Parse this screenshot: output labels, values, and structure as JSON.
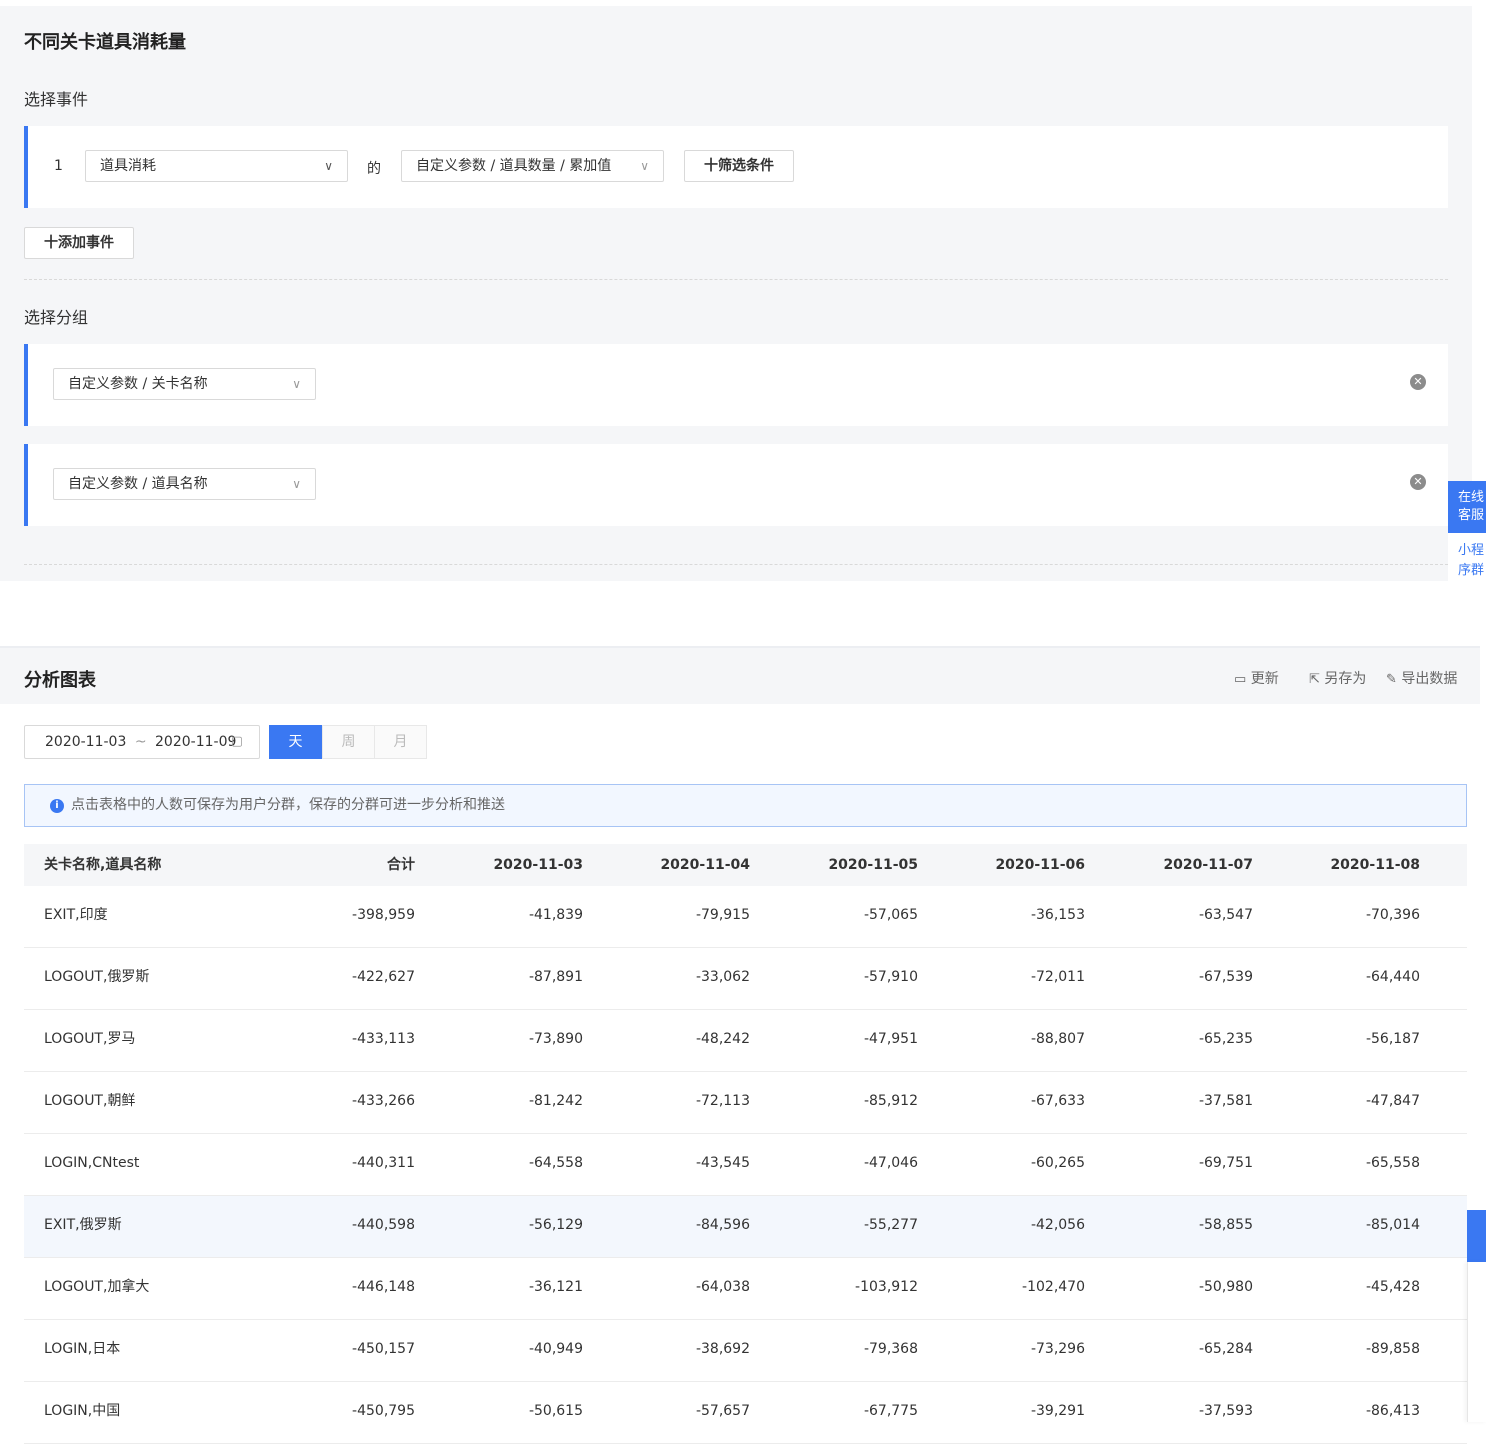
{
  "config": {
    "title": "不同关卡道具消耗量",
    "event_section_label": "选择事件",
    "event_row": {
      "index": "1",
      "event_select": "道具消耗",
      "of_label": "的",
      "metric_select": "自定义参数 / 道具数量 / 累加值",
      "filter_button": "十筛选条件"
    },
    "add_event_button": "十添加事件",
    "group_section_label": "选择分组",
    "groups": [
      {
        "select": "自定义参数 / 关卡名称"
      },
      {
        "select": "自定义参数 / 道具名称"
      }
    ],
    "side_tab": "在线客服",
    "side_link": "小程序群"
  },
  "analysis": {
    "title": "分析图表",
    "actions": {
      "refresh": "更新",
      "save_as": "另存为",
      "export": "导出数据"
    },
    "date_start": "2020-11-03",
    "date_sep": "~",
    "date_end": "2020-11-09",
    "granularity": [
      "天",
      "周",
      "月"
    ],
    "active_granularity": "天",
    "notice": "点击表格中的人数可保存为用户分群，保存的分群可进一步分析和推送"
  },
  "table": {
    "headers": [
      "关卡名称,道具名称",
      "合计",
      "2020-11-03",
      "2020-11-04",
      "2020-11-05",
      "2020-11-06",
      "2020-11-07",
      "2020-11-08"
    ],
    "rows": [
      [
        "EXIT,印度",
        "-398,959",
        "-41,839",
        "-79,915",
        "-57,065",
        "-36,153",
        "-63,547",
        "-70,396"
      ],
      [
        "LOGOUT,俄罗斯",
        "-422,627",
        "-87,891",
        "-33,062",
        "-57,910",
        "-72,011",
        "-67,539",
        "-64,440"
      ],
      [
        "LOGOUT,罗马",
        "-433,113",
        "-73,890",
        "-48,242",
        "-47,951",
        "-88,807",
        "-65,235",
        "-56,187"
      ],
      [
        "LOGOUT,朝鲜",
        "-433,266",
        "-81,242",
        "-72,113",
        "-85,912",
        "-67,633",
        "-37,581",
        "-47,847"
      ],
      [
        "LOGIN,CNtest",
        "-440,311",
        "-64,558",
        "-43,545",
        "-47,046",
        "-60,265",
        "-69,751",
        "-65,558"
      ],
      [
        "EXIT,俄罗斯",
        "-440,598",
        "-56,129",
        "-84,596",
        "-55,277",
        "-42,056",
        "-58,855",
        "-85,014"
      ],
      [
        "LOGOUT,加拿大",
        "-446,148",
        "-36,121",
        "-64,038",
        "-103,912",
        "-102,470",
        "-50,980",
        "-45,428"
      ],
      [
        "LOGIN,日本",
        "-450,157",
        "-40,949",
        "-38,692",
        "-79,368",
        "-73,296",
        "-65,284",
        "-89,858"
      ],
      [
        "LOGIN,中国",
        "-450,795",
        "-50,615",
        "-57,657",
        "-67,775",
        "-39,291",
        "-37,593",
        "-86,413"
      ]
    ],
    "highlighted_row": 5
  },
  "colors": {
    "accent": "#3a78f2",
    "panel_bg": "#f5f6f8",
    "row_highlight": "#f3f7fd"
  }
}
